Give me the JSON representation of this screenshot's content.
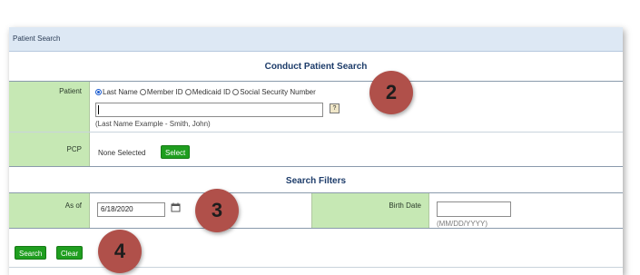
{
  "header": {
    "title": "Patient Search"
  },
  "section_conduct": {
    "title": "Conduct Patient Search"
  },
  "patient_row": {
    "label": "Patient",
    "options": [
      "Last Name",
      "Member ID",
      "Medicaid ID",
      "Social Security Number"
    ],
    "selected_option": "Last Name",
    "input_value": "",
    "help_icon": "question-help-icon",
    "hint": "(Last Name Example - Smith, John)"
  },
  "pcp_row": {
    "label": "PCP",
    "value": "None Selected",
    "select_button": "Select"
  },
  "section_filters": {
    "title": "Search Filters"
  },
  "as_of_row": {
    "label": "As of",
    "date_value": "6/18/2020",
    "calendar_icon": "calendar-icon"
  },
  "birth_date_row": {
    "label": "Birth Date",
    "input_value": "",
    "format_hint": "(MM/DD/YYYY)"
  },
  "actions": {
    "search": "Search",
    "clear": "Clear"
  },
  "callouts": {
    "c2": "2",
    "c3": "3",
    "c4": "4"
  },
  "colors": {
    "label_bg": "#c6e8b4",
    "header_bg": "#dde8f4",
    "button_green": "#1f9e1f",
    "callout_red": "#b0504a",
    "title_blue": "#1d3c6a"
  }
}
